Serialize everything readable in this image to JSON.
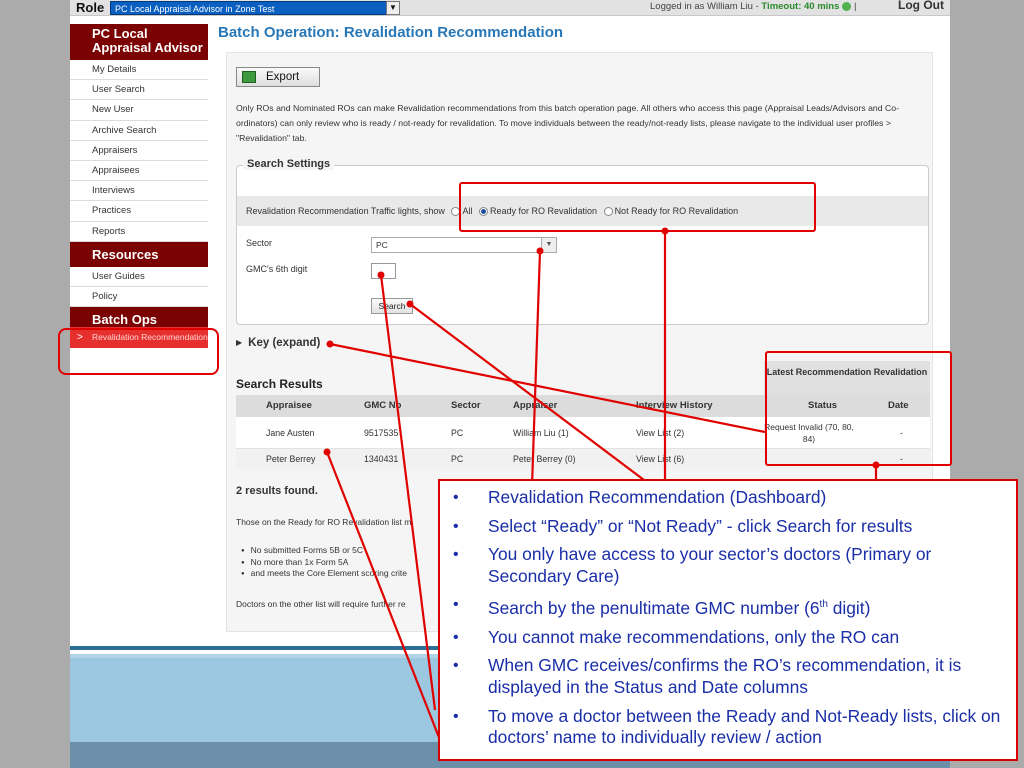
{
  "topbar": {
    "role_label": "Role",
    "role_value": "PC Local Appraisal Advisor in Zone Test",
    "logged_in": "Logged in as William Liu - ",
    "timeout": "Timeout: 40 mins",
    "separator": " | ",
    "logout": "Log Out"
  },
  "sidebar": {
    "heading": "PC Local Appraisal Advisor",
    "items": [
      "My Details",
      "User Search",
      "New User",
      "Archive Search",
      "Appraisers",
      "Appraisees",
      "Interviews",
      "Practices",
      "Reports"
    ],
    "resources_heading": "Resources",
    "resources": [
      "User Guides",
      "Policy"
    ],
    "batch_heading": "Batch Ops",
    "batch_item": "Revalidation Recommendation",
    "colors": {
      "heading_bg": "#7a0202",
      "active_bg": "#e6302e"
    }
  },
  "main": {
    "title": "Batch Operation: Revalidation Recommendation",
    "export_label": "Export",
    "intro": "Only ROs and Nominated ROs can make Revalidation recommendations from this batch operation page. All others who access this page (Appraisal Leads/Advisors and Co-ordinators) can only review who is ready / not-ready for revalidation. To move individuals between the ready/not-ready lists, please navigate to the individual user profiles > \"Revalidation\" tab.",
    "search_settings": {
      "legend": "Search Settings",
      "traffic_label": "Revalidation Recommendation Traffic lights, show",
      "options": [
        "All",
        "Ready for RO Revalidation",
        "Not Ready for RO Revalidation"
      ],
      "selected": "Ready for RO Revalidation",
      "sector_label": "Sector",
      "sector_value": "PC",
      "gmc_label": "GMC's 6th digit",
      "gmc_value": "",
      "search_label": "Search"
    },
    "key_expand": "Key (expand)",
    "results_title": "Search Results",
    "latest_header": "Latest Recommendation Revalidation",
    "columns": [
      "Appraisee",
      "GMC No",
      "Sector",
      "Appraiser",
      "Interview History",
      "Status",
      "Date"
    ],
    "rows": [
      {
        "appraisee": "Jane Austen",
        "gmc": "9517535",
        "sector": "PC",
        "appraiser": "William Liu (1)",
        "history": "View List (2)",
        "status": "Request Invalid (70, 80, 84)",
        "date": "-"
      },
      {
        "appraisee": "Peter Berrey",
        "gmc": "1340431",
        "sector": "PC",
        "appraiser": "Peter Berrey (0)",
        "history": "View List (6)",
        "status": "",
        "date": "-"
      }
    ],
    "found_text": "2 results found.",
    "ready_note": "Those on the Ready for RO Revalidation list m",
    "bullets": [
      "No submitted Forms 5B or 5C",
      "No more than 1x Form 5A",
      "and meets the Core Element scoring crite"
    ],
    "other_note": "Doctors on the other list will require further re"
  },
  "callout": {
    "items": [
      "Revalidation Recommendation (Dashboard)",
      "Select “Ready” or “Not Ready” - click Search for results",
      "You only have access to your sector’s doctors (Primary or Secondary Care)",
      "Search by the penultimate GMC number (6",
      "You cannot make recommendations, only the RO can",
      "When GMC receives/confirms the RO’s recommendation, it is displayed in the Status and Date columns",
      "To move a doctor between the Ready and Not-Ready lists, click on doctors’ name to individually review / action"
    ],
    "sup": "th",
    "item4_tail": " digit)",
    "accent": "#d80000",
    "text_color": "#1a2ea8"
  }
}
